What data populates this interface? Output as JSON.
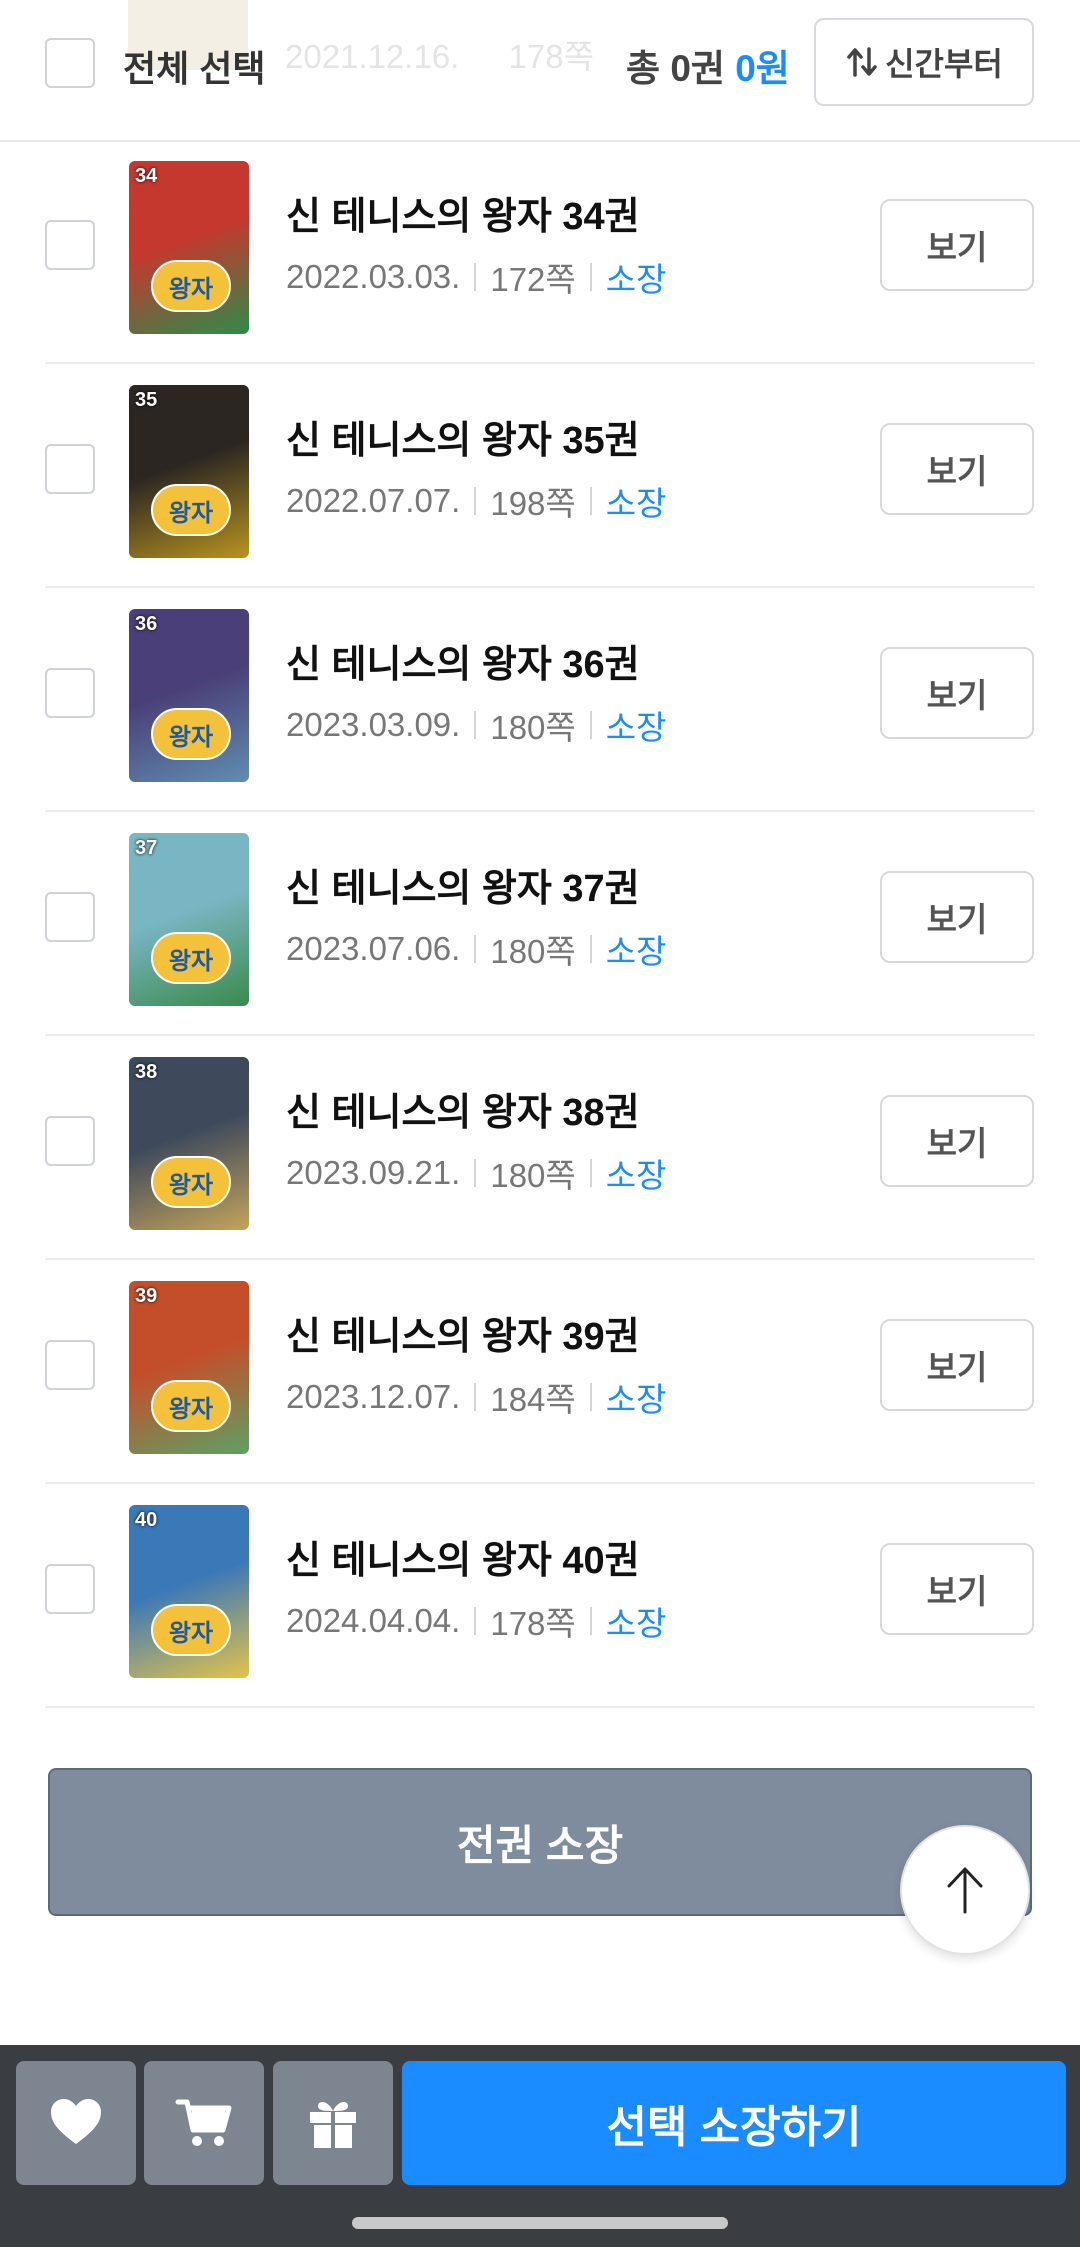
{
  "header": {
    "select_all_label": "전체 선택",
    "total_label": "총 0권",
    "total_price": "0원",
    "sort_label": "신간부터",
    "partial_row": {
      "date": "2021.12.16.",
      "pages": "178쪽"
    }
  },
  "books": [
    {
      "title": "신 테니스의 왕자 34권",
      "date": "2022.03.03.",
      "pages": "172쪽",
      "status": "소장",
      "view_label": "보기",
      "volume": "34",
      "cover_color": "#c5382e",
      "cover_color2": "#2f8a4a",
      "cover_logo": "왕자"
    },
    {
      "title": "신 테니스의 왕자 35권",
      "date": "2022.07.07.",
      "pages": "198쪽",
      "status": "소장",
      "view_label": "보기",
      "volume": "35",
      "cover_color": "#2b2622",
      "cover_color2": "#b8941f",
      "cover_logo": "왕자"
    },
    {
      "title": "신 테니스의 왕자 36권",
      "date": "2023.03.09.",
      "pages": "180쪽",
      "status": "소장",
      "view_label": "보기",
      "volume": "36",
      "cover_color": "#4a3f78",
      "cover_color2": "#5f8eb0",
      "cover_logo": "왕자"
    },
    {
      "title": "신 테니스의 왕자 37권",
      "date": "2023.07.06.",
      "pages": "180쪽",
      "status": "소장",
      "view_label": "보기",
      "volume": "37",
      "cover_color": "#79b6c4",
      "cover_color2": "#3b8a4c",
      "cover_logo": "왕자"
    },
    {
      "title": "신 테니스의 왕자 38권",
      "date": "2023.09.21.",
      "pages": "180쪽",
      "status": "소장",
      "view_label": "보기",
      "volume": "38",
      "cover_color": "#3e4a5c",
      "cover_color2": "#c4a35a",
      "cover_logo": "왕자"
    },
    {
      "title": "신 테니스의 왕자 39권",
      "date": "2023.12.07.",
      "pages": "184쪽",
      "status": "소장",
      "view_label": "보기",
      "volume": "39",
      "cover_color": "#c44e2a",
      "cover_color2": "#5fa063",
      "cover_logo": "왕자"
    },
    {
      "title": "신 테니스의 왕자 40권",
      "date": "2024.04.04.",
      "pages": "178쪽",
      "status": "소장",
      "view_label": "보기",
      "volume": "40",
      "cover_color": "#3a78b8",
      "cover_color2": "#e3c34a",
      "cover_logo": "왕자"
    }
  ],
  "buy_all_label": "전권 소장",
  "bottom_bar": {
    "purchase_label": "선택 소장하기",
    "icons": [
      "heart-icon",
      "cart-icon",
      "gift-icon"
    ]
  },
  "colors": {
    "accent": "#1a8cff",
    "buy_all_bg": "#7e8c9d",
    "bottom_bar_bg": "#3a3d42"
  }
}
